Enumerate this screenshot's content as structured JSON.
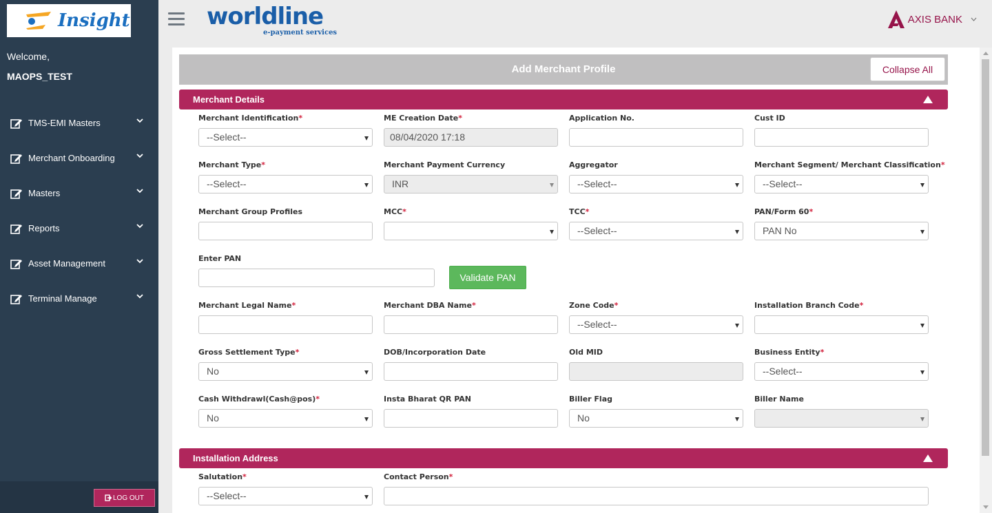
{
  "app": {
    "logo_text": "Insight",
    "brand": "worldline",
    "brand_sub": "e-payment services",
    "bank_name": "AXIS BANK"
  },
  "sidebar": {
    "welcome": "Welcome,",
    "username": "MAOPS_TEST",
    "items": [
      {
        "label": "TMS-EMI Masters",
        "icon": "edit-icon"
      },
      {
        "label": "Merchant Onboarding",
        "icon": "edit-icon"
      },
      {
        "label": "Masters",
        "icon": "edit-icon"
      },
      {
        "label": "Reports",
        "icon": "edit-icon"
      },
      {
        "label": "Asset Management",
        "icon": "edit-icon"
      },
      {
        "label": "Terminal Manage",
        "icon": "edit-icon"
      }
    ],
    "logout_label": "LOG OUT"
  },
  "page": {
    "title": "Add Merchant Profile",
    "collapse_label": "Collapse All"
  },
  "sections": {
    "merchant_details": "Merchant Details",
    "installation_address": "Installation Address"
  },
  "fields": {
    "merchant_identification": {
      "label": "Merchant Identification",
      "value": "--Select--"
    },
    "me_creation_date": {
      "label": "ME Creation Date",
      "value": "08/04/2020 17:18"
    },
    "application_no": {
      "label": "Application No.",
      "value": ""
    },
    "cust_id": {
      "label": "Cust ID",
      "value": ""
    },
    "merchant_type": {
      "label": "Merchant Type",
      "value": "--Select--"
    },
    "merchant_payment_currency": {
      "label": "Merchant Payment Currency",
      "value": "INR"
    },
    "aggregator": {
      "label": "Aggregator",
      "value": "--Select--"
    },
    "merchant_segment": {
      "label": "Merchant Segment/ Merchant Classification",
      "value": "--Select--"
    },
    "merchant_group_profiles": {
      "label": "Merchant Group Profiles",
      "value": ""
    },
    "mcc": {
      "label": "MCC",
      "value": ""
    },
    "tcc": {
      "label": "TCC",
      "value": "--Select--"
    },
    "pan_form60": {
      "label": "PAN/Form 60",
      "value": "PAN No"
    },
    "enter_pan": {
      "label": "Enter PAN",
      "value": ""
    },
    "validate_pan_label": "Validate PAN",
    "merchant_legal_name": {
      "label": "Merchant Legal Name",
      "value": ""
    },
    "merchant_dba_name": {
      "label": "Merchant DBA Name",
      "value": ""
    },
    "zone_code": {
      "label": "Zone Code",
      "value": "--Select--"
    },
    "installation_branch_code": {
      "label": "Installation Branch Code",
      "value": ""
    },
    "gross_settlement_type": {
      "label": "Gross Settlement Type",
      "value": "No"
    },
    "dob_incorporation_date": {
      "label": "DOB/Incorporation Date",
      "value": ""
    },
    "old_mid": {
      "label": "Old MID",
      "value": ""
    },
    "business_entity": {
      "label": "Business Entity",
      "value": "--Select--"
    },
    "cash_withdrawl": {
      "label": "Cash Withdrawl(Cash@pos)",
      "value": "No"
    },
    "insta_bharat_qr_pan": {
      "label": "Insta Bharat QR PAN",
      "value": ""
    },
    "biller_flag": {
      "label": "Biller Flag",
      "value": "No"
    },
    "biller_name": {
      "label": "Biller Name",
      "value": ""
    },
    "salutation": {
      "label": "Salutation",
      "value": "--Select--"
    },
    "contact_person": {
      "label": "Contact Person",
      "value": ""
    }
  },
  "colors": {
    "sidebar": "#2b3e50",
    "accent": "#b0265c",
    "validate": "#5cb85c",
    "brand": "#1a5ea8"
  }
}
